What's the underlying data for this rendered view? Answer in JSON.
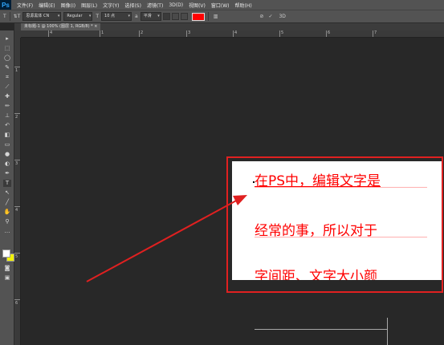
{
  "app": {
    "logo": "Ps"
  },
  "menu": [
    "文件(F)",
    "编辑(E)",
    "图像(I)",
    "图层(L)",
    "文字(Y)",
    "选择(S)",
    "滤镜(T)",
    "3D(D)",
    "视图(V)",
    "窗口(W)",
    "帮助(H)"
  ],
  "options": {
    "tool_icon": "T",
    "orient_icon": "⇅T",
    "font_family": "思源黑体 CN",
    "font_style": "Regular",
    "size_icon": "T",
    "font_size": "10 点",
    "aa_icon": "a",
    "antialias": "平滑",
    "text_color": "#ff0000",
    "cancel_icon": "⊘",
    "commit_icon": "✓",
    "threed_label": "3D"
  },
  "document": {
    "tab_title": "未标题-1 @ 100% (图层 1, RGB/8) * ×",
    "lines": [
      "在PS中，编辑文字是",
      "经常的事，所以对于",
      "字间距、文字大小颜"
    ]
  },
  "rulers": {
    "h_labels": [
      "4",
      "1",
      "2",
      "3",
      "4",
      "5",
      "6",
      "7"
    ],
    "v_labels": [
      "1",
      "2",
      "3",
      "4",
      "5",
      "6"
    ]
  },
  "colors": {
    "annotation": "#e02020",
    "text": "#ff0000",
    "canvas": "#ffffff"
  }
}
